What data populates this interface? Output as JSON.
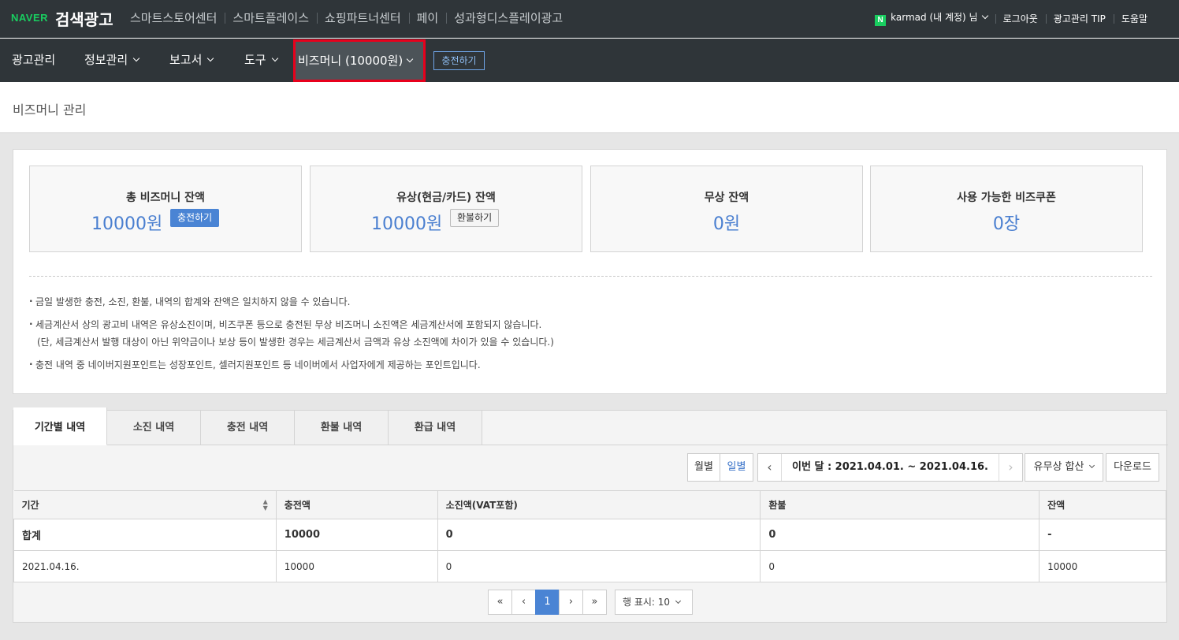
{
  "topbar": {
    "brand": "NAVER",
    "title": "검색광고",
    "links": [
      "스마트스토어센터",
      "스마트플레이스",
      "쇼핑파트너센터",
      "페이",
      "성과형디스플레이광고"
    ],
    "account_badge": "N",
    "account": "karmad (내 계정) 님",
    "logout": "로그아웃",
    "tip": "광고관리 TIP",
    "help": "도움말"
  },
  "nav": {
    "ad_manage": "광고관리",
    "info_manage": "정보관리",
    "report": "보고서",
    "tools": "도구",
    "bizmoney": "비즈머니 (10000원)",
    "charge": "충전하기"
  },
  "page": {
    "title": "비즈머니 관리"
  },
  "cards": [
    {
      "label": "총 비즈머니 잔액",
      "value": "10000원",
      "button": "충전하기"
    },
    {
      "label": "유상(현금/카드) 잔액",
      "value": "10000원",
      "button": "환불하기"
    },
    {
      "label": "무상 잔액",
      "value": "0원"
    },
    {
      "label": "사용 가능한 비즈쿠폰",
      "value": "0장"
    }
  ],
  "notes": [
    "금일 발생한 충전, 소진, 환불, 내역의 합계와 잔액은 일치하지 않을 수 있습니다.",
    "세금계산서 상의 광고비 내역은 유상소진이며, 비즈쿠폰 등으로 충전된 무상 비즈머니 소진액은 세금계산서에 포함되지 않습니다.",
    "(단, 세금계산서 발행 대상이 아닌 위약금이나 보상 등이 발생한 경우는 세금계산서 금액과 유상 소진액에 차이가 있을 수 있습니다.)",
    "충전 내역 중 네이버지원포인트는 성장포인트, 셀러지원포인트 등 네이버에서 사업자에게 제공하는 포인트입니다."
  ],
  "tabs": [
    "기간별 내역",
    "소진 내역",
    "충전 내역",
    "환불 내역",
    "환급 내역"
  ],
  "toolbar": {
    "monthly": "월별",
    "daily": "일별",
    "date_range": "이번 달 : 2021.04.01. ~ 2021.04.16.",
    "filter": "유무상 합산",
    "download": "다운로드"
  },
  "table": {
    "headers": [
      "기간",
      "충전액",
      "소진액(VAT포함)",
      "환불",
      "잔액"
    ],
    "sum_row": [
      "합계",
      "10000",
      "0",
      "0",
      "-"
    ],
    "rows": [
      [
        "2021.04.16.",
        "10000",
        "0",
        "0",
        "10000"
      ]
    ]
  },
  "pager": {
    "first": "«",
    "prev": "‹",
    "current": "1",
    "next": "›",
    "last": "»",
    "rows_per_page": "행 표시: 10"
  },
  "colors": {
    "topbar_bg": "#2f3539",
    "accent_blue": "#4a84d4",
    "highlight_red": "#e8001c",
    "naver_green": "#19ce60"
  }
}
